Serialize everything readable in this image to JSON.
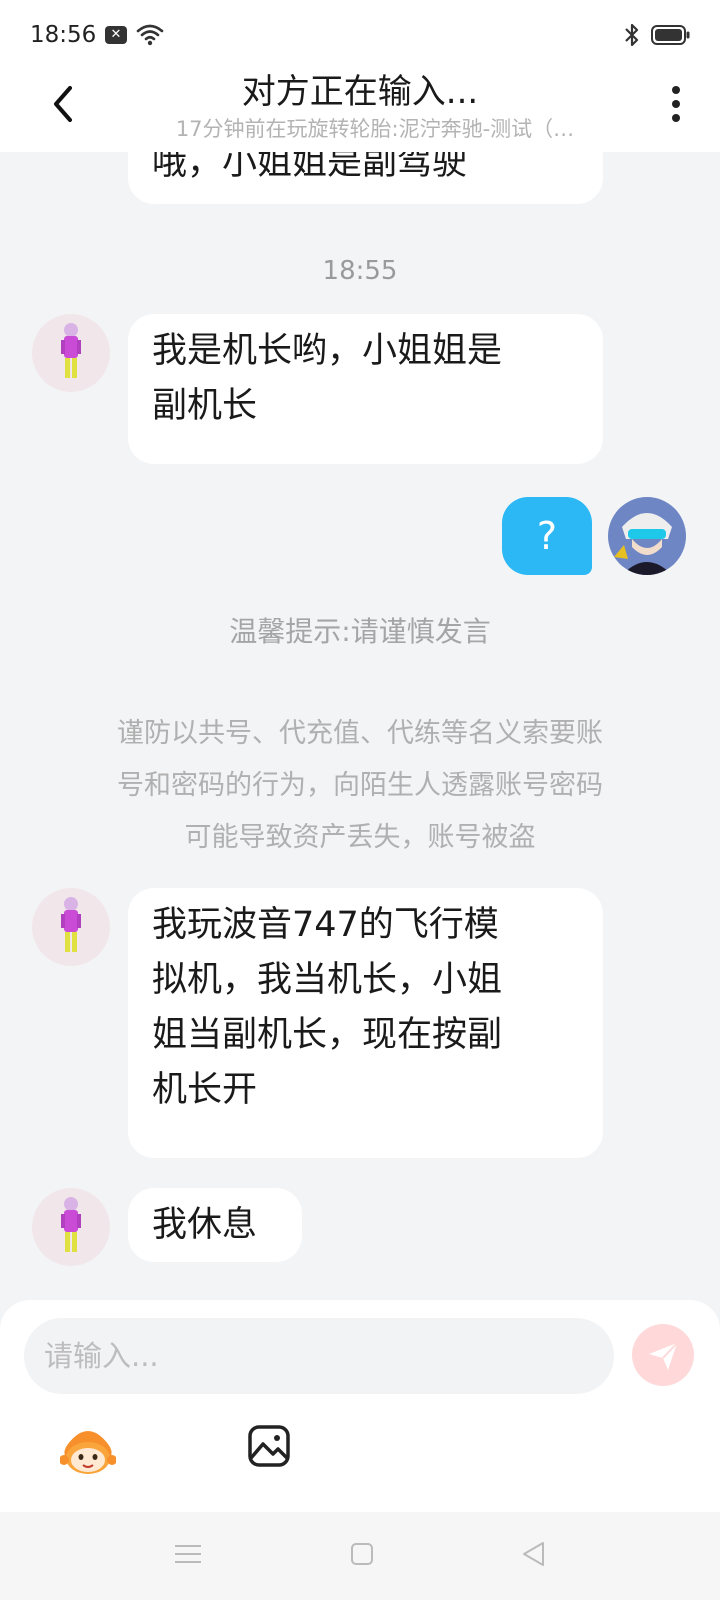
{
  "status_bar": {
    "time": "18:56",
    "icons": [
      "notification-x-icon",
      "wifi-icon",
      "bluetooth-icon",
      "battery-icon"
    ]
  },
  "header": {
    "title": "对方正在输入...",
    "subtitle": "17分钟前在玩旋转轮胎:泥泞奔驰-测试（…",
    "back_icon": "chevron-left-icon",
    "more_icon": "more-vertical-icon"
  },
  "chat": {
    "partial_message": "哦，小姐姐是副驾驶",
    "timestamp": "18:55",
    "messages": [
      {
        "from": "other",
        "text_lines": [
          "我是机长哟，小姐姐是",
          "副机长"
        ]
      },
      {
        "from": "me",
        "text": "?"
      },
      {
        "from": "other",
        "text_lines": [
          "我玩波音747的飞行模",
          "拟机，我当机长，小姐",
          "姐当副机长，现在按副",
          "机长开"
        ]
      },
      {
        "from": "other",
        "text_lines": [
          "我休息"
        ]
      }
    ],
    "tip": "温馨提示:请谨慎发言",
    "warning_lines": [
      "谨防以共号、代充值、代练等名义索要账",
      "号和密码的行为，向陌生人透露账号密码",
      "可能导致资产丢失，账号被盗"
    ]
  },
  "input": {
    "placeholder": "请输入...",
    "value": ""
  },
  "colors": {
    "my_bubble": "#2bb8f5",
    "chat_bg": "#f3f4f6",
    "send_button": "#ffd9d9"
  }
}
